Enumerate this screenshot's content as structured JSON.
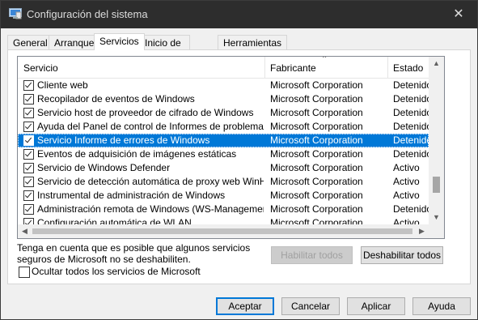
{
  "window": {
    "title": "Configuración del sistema",
    "close_glyph": "✕",
    "icon": "system-config-icon"
  },
  "tabs": [
    {
      "label": "General"
    },
    {
      "label": "Arranque"
    },
    {
      "label": "Servicios",
      "active": true
    },
    {
      "label": "Inicio de Windows"
    },
    {
      "label": "Herramientas"
    }
  ],
  "table": {
    "headers": {
      "service": "Servicio",
      "manufacturer": "Fabricante",
      "status": "Estado"
    },
    "rows": [
      {
        "service": "Cliente web",
        "manufacturer": "Microsoft Corporation",
        "status": "Detenido",
        "checked": true
      },
      {
        "service": "Recopilador de eventos de Windows",
        "manufacturer": "Microsoft Corporation",
        "status": "Detenido",
        "checked": true
      },
      {
        "service": "Servicio host de proveedor de cifrado de Windows",
        "manufacturer": "Microsoft Corporation",
        "status": "Detenido",
        "checked": true
      },
      {
        "service": "Ayuda del Panel de control de Informes de problemas y ...",
        "manufacturer": "Microsoft Corporation",
        "status": "Detenido",
        "checked": true
      },
      {
        "service": "Servicio Informe de errores de Windows",
        "manufacturer": "Microsoft Corporation",
        "status": "Detenido",
        "checked": true,
        "selected": true
      },
      {
        "service": "Eventos de adquisición de imágenes estáticas",
        "manufacturer": "Microsoft Corporation",
        "status": "Detenido",
        "checked": true
      },
      {
        "service": "Servicio de Windows Defender",
        "manufacturer": "Microsoft Corporation",
        "status": "Activo",
        "checked": true
      },
      {
        "service": "Servicio de detección automática de proxy web WinHTTP",
        "manufacturer": "Microsoft Corporation",
        "status": "Activo",
        "checked": true
      },
      {
        "service": "Instrumental de administración de Windows",
        "manufacturer": "Microsoft Corporation",
        "status": "Activo",
        "checked": true
      },
      {
        "service": "Administración remota de Windows (WS-Management)",
        "manufacturer": "Microsoft Corporation",
        "status": "Detenido",
        "checked": true
      },
      {
        "service": "Configuración automática de WLAN",
        "manufacturer": "Microsoft Corporation",
        "status": "Activo",
        "checked": true
      }
    ]
  },
  "note": "Tenga en cuenta que es posible que algunos servicios seguros de Microsoft no se deshabiliten.",
  "buttons": {
    "enable_all": "Habilitar todos",
    "disable_all": "Deshabilitar todos",
    "accept": "Aceptar",
    "cancel": "Cancelar",
    "apply": "Aplicar",
    "help": "Ayuda"
  },
  "hide_ms": {
    "label": "Ocultar todos los servicios de Microsoft",
    "checked": false
  }
}
